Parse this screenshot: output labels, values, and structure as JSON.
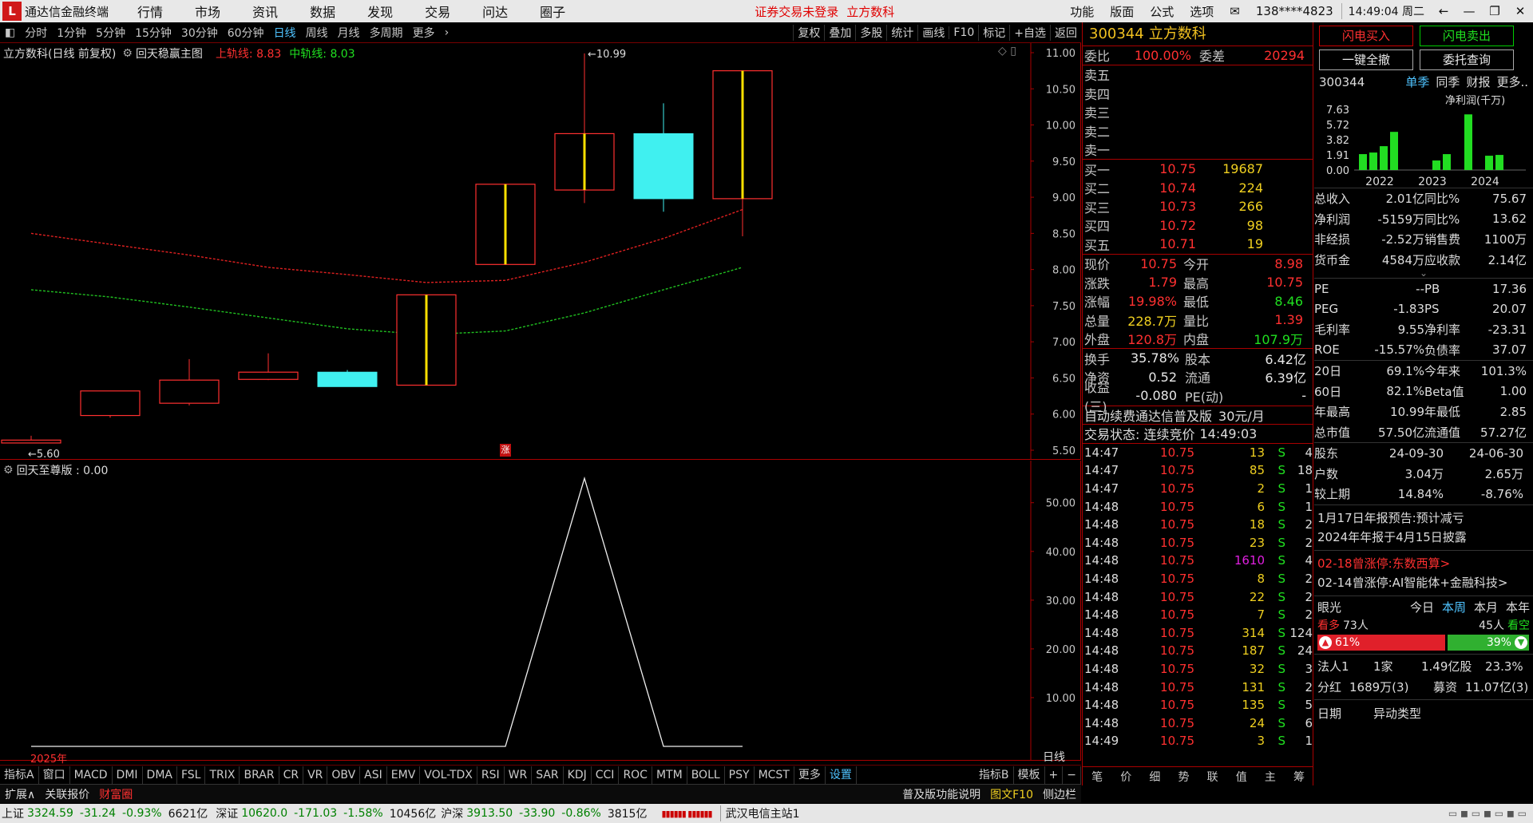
{
  "window": {
    "app_name": "通达信金融终端",
    "menus": [
      "行情",
      "市场",
      "资讯",
      "数据",
      "发现",
      "交易",
      "问达",
      "圈子"
    ],
    "notice": "证券交易未登录",
    "notice_stock": "立方数科",
    "right_menus": [
      "功能",
      "版面",
      "公式",
      "选项"
    ],
    "account": "138****4823",
    "clock": "14:49:04 周二"
  },
  "toolbar": {
    "periods": [
      "分时",
      "1分钟",
      "5分钟",
      "15分钟",
      "30分钟",
      "60分钟",
      "日线",
      "周线",
      "月线",
      "多周期",
      "更多"
    ],
    "active_period": "日线",
    "right_buttons": [
      "复权",
      "叠加",
      "多股",
      "统计",
      "画线",
      "F10",
      "标记",
      "+自选",
      "返回"
    ]
  },
  "main_legend": {
    "name": "立方数科(日线 前复权)",
    "indicator": "回天稳赢主图",
    "upper_label": "上轨线: 8.83",
    "mid_label": "中轨线: 8.03"
  },
  "sub_legend": {
    "name": "回天至尊版 : 0.00"
  },
  "axis_label_year": "2025年",
  "axis_label_period": "日线",
  "limit_mark": "涨",
  "chart_data": [
    {
      "type": "candlestick",
      "title": "立方数科(日线 前复权)",
      "ylim": [
        5.5,
        11.0
      ],
      "yticks": [
        "11.00",
        "10.50",
        "10.00",
        "9.50",
        "9.00",
        "8.50",
        "8.00",
        "7.50",
        "7.00",
        "6.50",
        "6.00",
        "5.50"
      ],
      "candles": [
        {
          "open": 5.6,
          "close": 5.64,
          "high": 5.7,
          "low": 5.6,
          "color": "red"
        },
        {
          "open": 5.98,
          "close": 6.32,
          "high": 6.32,
          "low": 5.95,
          "color": "red"
        },
        {
          "open": 6.15,
          "close": 6.47,
          "high": 6.76,
          "low": 6.12,
          "color": "red"
        },
        {
          "open": 6.48,
          "close": 6.58,
          "high": 6.84,
          "low": 6.47,
          "color": "red"
        },
        {
          "open": 6.58,
          "close": 6.38,
          "high": 6.61,
          "low": 6.38,
          "color": "cyan"
        },
        {
          "open": 6.4,
          "close": 7.65,
          "high": 7.65,
          "low": 6.4,
          "color": "red"
        },
        {
          "open": 8.07,
          "close": 9.18,
          "high": 9.18,
          "low": 8.07,
          "color": "red"
        },
        {
          "open": 9.1,
          "close": 9.88,
          "high": 10.99,
          "low": 8.92,
          "color": "red"
        },
        {
          "open": 9.88,
          "close": 8.98,
          "high": 10.3,
          "low": 8.8,
          "color": "cyan"
        },
        {
          "open": 8.98,
          "close": 10.75,
          "high": 10.75,
          "low": 8.46,
          "color": "red"
        }
      ],
      "annotations": {
        "high": "10.99",
        "low": "5.60"
      },
      "series": [
        {
          "name": "上轨线",
          "values": [
            8.5,
            8.35,
            8.2,
            8.03,
            7.93,
            7.82,
            7.85,
            8.1,
            8.43,
            8.83
          ]
        },
        {
          "name": "中轨线",
          "values": [
            7.72,
            7.62,
            7.48,
            7.33,
            7.18,
            7.1,
            7.15,
            7.4,
            7.72,
            8.03
          ]
        }
      ]
    },
    {
      "type": "line",
      "title": "回天至尊版",
      "ylim": [
        0,
        57
      ],
      "yticks": [
        "50.00",
        "40.00",
        "30.00",
        "20.00",
        "10.00"
      ],
      "series": [
        {
          "name": "回天至尊版",
          "values": [
            0,
            0,
            0,
            0,
            0,
            0,
            0,
            55,
            0,
            0
          ]
        }
      ]
    }
  ],
  "indicator_tabs": [
    "指标A",
    "窗口",
    "MACD",
    "DMI",
    "DMA",
    "FSL",
    "TRIX",
    "BRAR",
    "CR",
    "VR",
    "OBV",
    "ASI",
    "EMV",
    "VOL-TDX",
    "RSI",
    "WR",
    "SAR",
    "KDJ",
    "CCI",
    "ROC",
    "MTM",
    "BOLL",
    "PSY",
    "MCST",
    "更多",
    "设置"
  ],
  "indicator_tabs_right": [
    "指标B",
    "模板"
  ],
  "bottom_left": [
    "扩展∧",
    "关联报价",
    "财富圈"
  ],
  "bottom_right": [
    "普及版功能说明",
    "图文F10",
    "侧边栏"
  ],
  "quote": {
    "code": "300344",
    "name": "立方数科",
    "weibi_label": "委比",
    "weibi": "100.00%",
    "weicha_label": "委差",
    "weicha": "20294",
    "asks": [
      "卖五",
      "卖四",
      "卖三",
      "卖二",
      "卖一"
    ],
    "bids": [
      {
        "label": "买一",
        "price": "10.75",
        "vol": "19687"
      },
      {
        "label": "买二",
        "price": "10.74",
        "vol": "224"
      },
      {
        "label": "买三",
        "price": "10.73",
        "vol": "266"
      },
      {
        "label": "买四",
        "price": "10.72",
        "vol": "98"
      },
      {
        "label": "买五",
        "price": "10.71",
        "vol": "19"
      }
    ],
    "stats": [
      {
        "l1": "现价",
        "v1": "10.75",
        "c1": "red",
        "l2": "今开",
        "v2": "8.98",
        "c2": "red"
      },
      {
        "l1": "涨跌",
        "v1": "1.79",
        "c1": "red",
        "l2": "最高",
        "v2": "10.75",
        "c2": "red"
      },
      {
        "l1": "涨幅",
        "v1": "19.98%",
        "c1": "red",
        "l2": "最低",
        "v2": "8.46",
        "c2": "green"
      },
      {
        "l1": "总量",
        "v1": "228.7万",
        "c1": "yellow",
        "l2": "量比",
        "v2": "1.39",
        "c2": "red"
      },
      {
        "l1": "外盘",
        "v1": "120.8万",
        "c1": "red",
        "l2": "内盘",
        "v2": "107.9万",
        "c2": "green"
      }
    ],
    "stats2": [
      {
        "l1": "换手",
        "v1": "35.78%",
        "l2": "股本",
        "v2": "6.42亿"
      },
      {
        "l1": "净资",
        "v1": "0.52",
        "l2": "流通",
        "v2": "6.39亿"
      },
      {
        "l1": "收益(三)",
        "v1": "-0.080",
        "l2": "PE(动)",
        "v2": "-"
      }
    ],
    "fee_text": "自动续费通达信普及版",
    "fee_price": "30元/月",
    "state_text": "交易状态: 连续竞价",
    "state_time": "14:49:03",
    "ticks": [
      [
        "14:47",
        "10.75",
        "13",
        "S",
        "4"
      ],
      [
        "14:47",
        "10.75",
        "85",
        "S",
        "18"
      ],
      [
        "14:47",
        "10.75",
        "2",
        "S",
        "1"
      ],
      [
        "14:48",
        "10.75",
        "6",
        "S",
        "1"
      ],
      [
        "14:48",
        "10.75",
        "18",
        "S",
        "2"
      ],
      [
        "14:48",
        "10.75",
        "23",
        "S",
        "2"
      ],
      [
        "14:48",
        "10.75",
        "1610",
        "S",
        "4"
      ],
      [
        "14:48",
        "10.75",
        "8",
        "S",
        "2"
      ],
      [
        "14:48",
        "10.75",
        "22",
        "S",
        "2"
      ],
      [
        "14:48",
        "10.75",
        "7",
        "S",
        "2"
      ],
      [
        "14:48",
        "10.75",
        "314",
        "S",
        "124"
      ],
      [
        "14:48",
        "10.75",
        "187",
        "S",
        "24"
      ],
      [
        "14:48",
        "10.75",
        "32",
        "S",
        "3"
      ],
      [
        "14:48",
        "10.75",
        "131",
        "S",
        "2"
      ],
      [
        "14:48",
        "10.75",
        "135",
        "S",
        "5"
      ],
      [
        "14:48",
        "10.75",
        "24",
        "S",
        "6"
      ],
      [
        "14:49",
        "10.75",
        "3",
        "S",
        "1"
      ]
    ],
    "bottom_tabs": [
      "笔",
      "价",
      "细",
      "势",
      "联",
      "值",
      "主",
      "筹"
    ]
  },
  "f10": {
    "buy_btn": "闪电买入",
    "sell_btn": "闪电卖出",
    "cancel_btn": "一键全撤",
    "query_btn": "委托查询",
    "code": "300344",
    "tabs": [
      "单季",
      "同季",
      "财报",
      "更多.."
    ],
    "chart_label": "净利润(千万)",
    "chart_yticks": [
      "7.63",
      "5.72",
      "3.82",
      "1.91",
      "0.00"
    ],
    "chart_years": [
      "2022",
      "2023",
      "2024"
    ],
    "bar_values": [
      2.0,
      2.2,
      3.0,
      4.8,
      0,
      0,
      1.2,
      2.0,
      7.0,
      0,
      1.8,
      1.9
    ],
    "fin": [
      [
        "总收入",
        "2.01亿",
        "同比%",
        "75.67"
      ],
      [
        "净利润",
        "-5159万",
        "同比%",
        "13.62"
      ],
      [
        "非经损",
        "-2.52万",
        "销售费",
        "1100万"
      ],
      [
        "货币金",
        "4584万",
        "应收款",
        "2.14亿"
      ]
    ],
    "val": [
      [
        "PE",
        "--",
        "PB",
        "17.36"
      ],
      [
        "PEG",
        "-1.83",
        "PS",
        "20.07"
      ],
      [
        "毛利率",
        "9.55",
        "净利率",
        "-23.31"
      ],
      [
        "ROE",
        "-15.57%",
        "负债率",
        "37.07"
      ]
    ],
    "perf": [
      [
        "20日",
        "69.1%",
        "今年来",
        "101.3%"
      ],
      [
        "60日",
        "82.1%",
        "Beta值",
        "1.00"
      ],
      [
        "年最高",
        "10.99",
        "年最低",
        "2.85"
      ],
      [
        "总市值",
        "57.50亿",
        "流通值",
        "57.27亿"
      ]
    ],
    "holders": [
      [
        "股东",
        "24-09-30",
        "24-06-30"
      ],
      [
        "户数",
        "3.04万",
        "2.65万"
      ],
      [
        "较上期",
        "14.84%",
        "-8.76%"
      ]
    ],
    "news": [
      "1月17日年报预告:预计减亏",
      "2024年年报于4月15日披露"
    ],
    "limit_news": [
      "02-18曾涨停:东数西算>",
      "02-14曾涨停:AI智能体+金融科技>"
    ],
    "eye_label": "眼光",
    "eye_tabs": [
      "今日",
      "本周",
      "本月",
      "本年"
    ],
    "bull_label": "看多",
    "bull_count": "73人",
    "bear_count": "45人",
    "bear_label": "看空",
    "bull_pct": "61%",
    "bear_pct": "39%",
    "inst_label": "法人1",
    "inst_count": "1家",
    "inst_shares": "1.49亿股",
    "inst_pct": "23.3%",
    "div_label": "分红",
    "div_val": "1689万(3)",
    "fund_label": "募资",
    "fund_val": "11.07亿(3)",
    "date_label": "日期",
    "type_label": "异动类型"
  },
  "statusbar": {
    "sh_name": "上证",
    "sh_val": "3324.59",
    "sh_chg": "-31.24",
    "sh_pct": "-0.93%",
    "sh_amt": "6621亿",
    "sz_name": "深证",
    "sz_val": "10620.0",
    "sz_chg": "-171.03",
    "sz_pct": "-1.58%",
    "sz_amt": "10456亿",
    "hs_name": "沪深",
    "hs_val": "3913.50",
    "hs_chg": "-33.90",
    "hs_pct": "-0.86%",
    "hs_amt": "3815亿",
    "server": "武汉电信主站1"
  }
}
